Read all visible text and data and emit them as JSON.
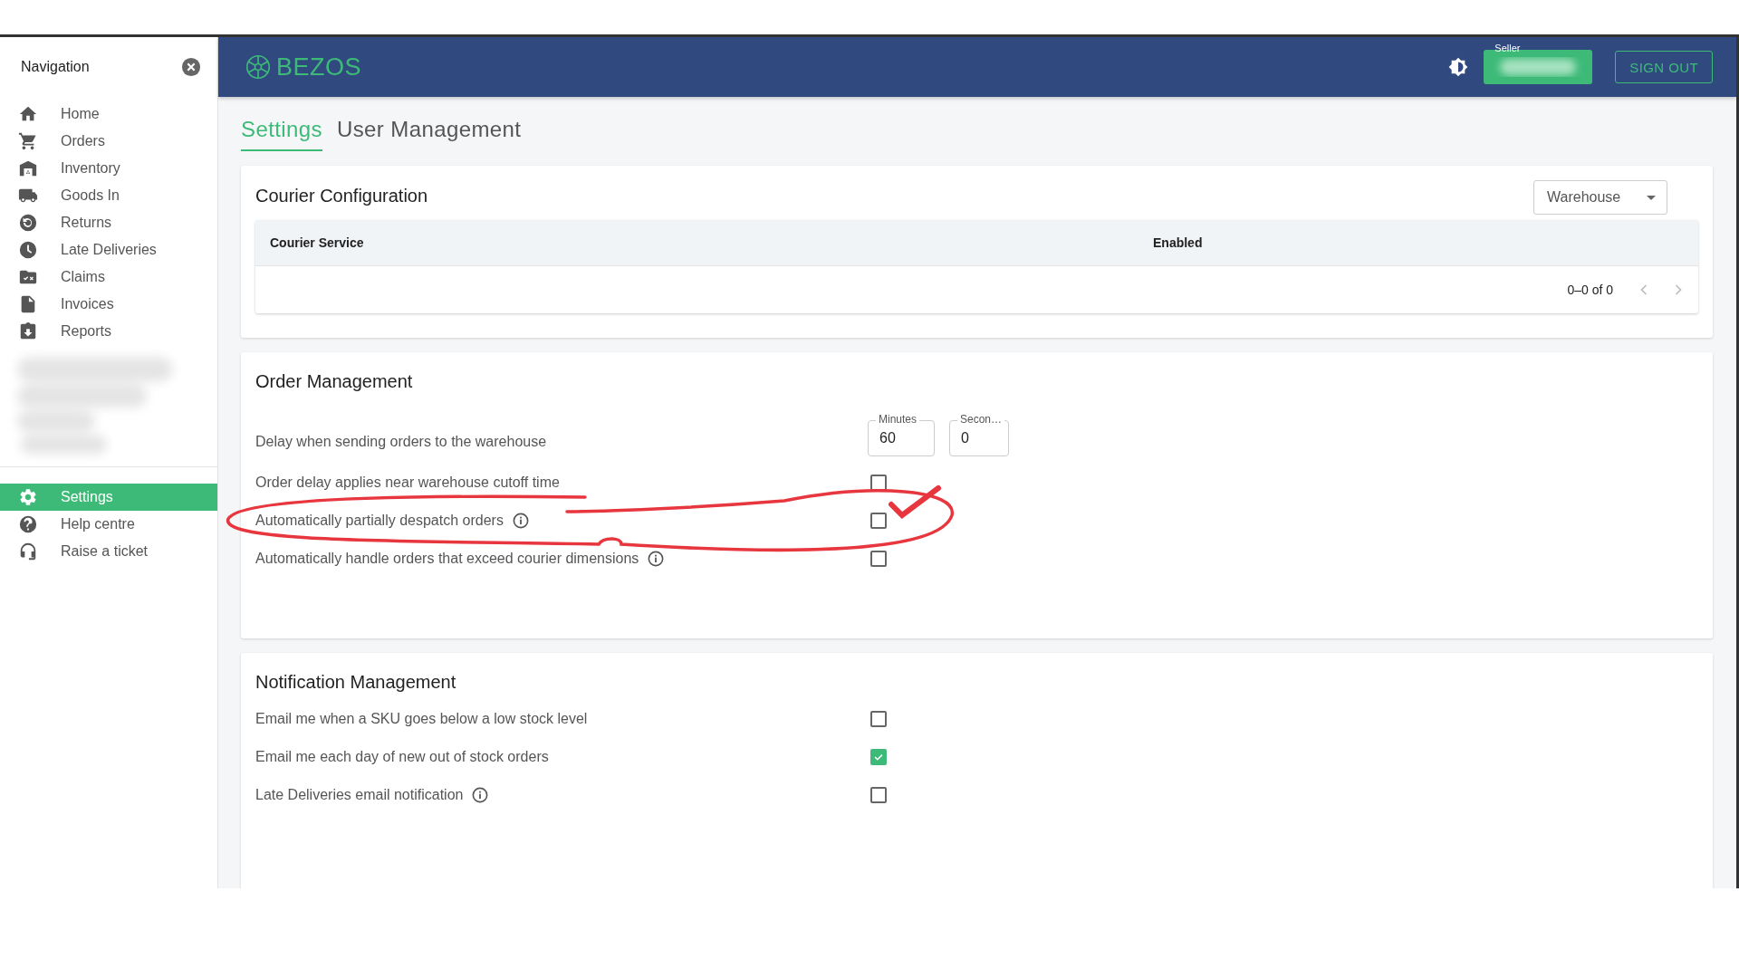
{
  "sidebar": {
    "title": "Navigation",
    "items": [
      {
        "label": "Home",
        "selected": false
      },
      {
        "label": "Orders",
        "selected": false
      },
      {
        "label": "Inventory",
        "selected": false
      },
      {
        "label": "Goods In",
        "selected": false
      },
      {
        "label": "Returns",
        "selected": false
      },
      {
        "label": "Late Deliveries",
        "selected": false
      },
      {
        "label": "Claims",
        "selected": false
      },
      {
        "label": "Invoices",
        "selected": false
      },
      {
        "label": "Reports",
        "selected": false
      }
    ],
    "footer_items": [
      {
        "label": "Settings",
        "selected": true
      },
      {
        "label": "Help centre",
        "selected": false
      },
      {
        "label": "Raise a ticket",
        "selected": false
      }
    ]
  },
  "header": {
    "logo": "BEZOS",
    "account_label": "Seller",
    "sign_out": "SIGN OUT"
  },
  "tabs": [
    {
      "label": "Settings",
      "selected": true
    },
    {
      "label": "User Management",
      "selected": false
    }
  ],
  "courier_configuration": {
    "title": "Courier Configuration",
    "dropdown": {
      "value": "Warehouse"
    },
    "table": {
      "columns": [
        "Courier Service",
        "Enabled"
      ],
      "pagination": "0–0 of 0"
    }
  },
  "order_management": {
    "title": "Order Management",
    "settings": [
      {
        "kind": "duration",
        "label": "Delay when sending orders to the warehouse",
        "fields": [
          {
            "label": "Minutes",
            "value": "60"
          },
          {
            "label": "Secon…",
            "value": "0"
          }
        ]
      },
      {
        "kind": "checkbox",
        "label": "Order delay applies near warehouse cutoff time",
        "info": false,
        "checked": false
      },
      {
        "kind": "checkbox",
        "label": "Automatically partially despatch orders",
        "info": true,
        "checked": false
      },
      {
        "kind": "checkbox",
        "label": "Automatically handle orders that exceed courier dimensions",
        "info": true,
        "checked": false
      }
    ]
  },
  "notification_management": {
    "title": "Notification Management",
    "settings": [
      {
        "kind": "checkbox",
        "label": "Email me when a SKU goes below a low stock level",
        "info": false,
        "checked": false
      },
      {
        "kind": "checkbox",
        "label": "Email me each day of new out of stock orders",
        "info": false,
        "checked": true
      },
      {
        "kind": "checkbox",
        "label": "Late Deliveries email notification",
        "info": true,
        "checked": false
      }
    ]
  }
}
